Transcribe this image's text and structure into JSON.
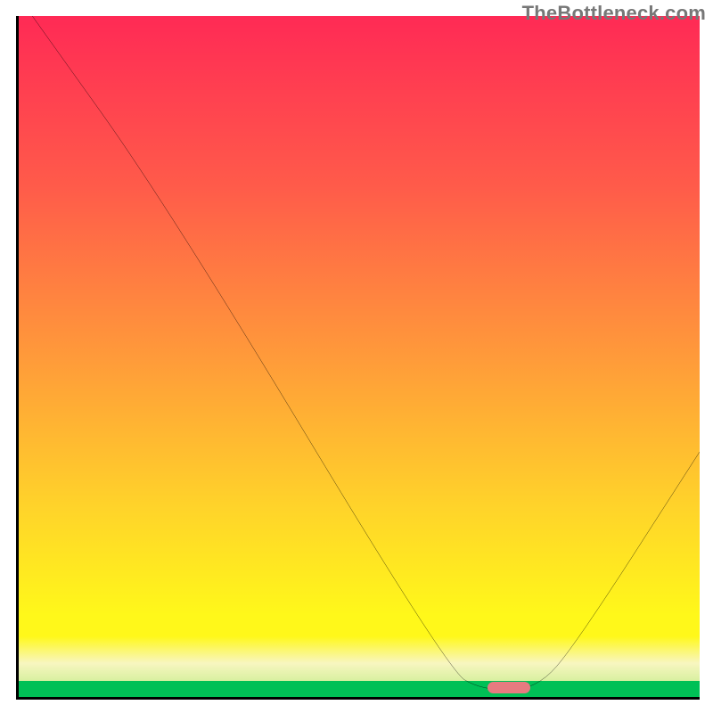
{
  "watermark": "TheBottleneck.com",
  "colors": {
    "gradient_stops": [
      {
        "offset": 0,
        "color": "#ff2a55"
      },
      {
        "offset": 25,
        "color": "#ff5b4a"
      },
      {
        "offset": 50,
        "color": "#ff9a3a"
      },
      {
        "offset": 72,
        "color": "#ffd32a"
      },
      {
        "offset": 88,
        "color": "#fff81a"
      },
      {
        "offset": 100,
        "color": "#fff81a"
      }
    ],
    "green_band": "#00c056",
    "marker": "#e77b80",
    "curve": "#000000"
  },
  "chart_data": {
    "type": "line",
    "title": "",
    "xlabel": "",
    "ylabel": "",
    "xlim": [
      0,
      100
    ],
    "ylim": [
      0,
      100
    ],
    "sweet_spot_x_range": [
      68,
      76
    ],
    "curve_points": [
      {
        "x": 2,
        "y": 100
      },
      {
        "x": 22,
        "y": 72
      },
      {
        "x": 63,
        "y": 4
      },
      {
        "x": 68,
        "y": 1
      },
      {
        "x": 76,
        "y": 1
      },
      {
        "x": 82,
        "y": 8
      },
      {
        "x": 100,
        "y": 36
      }
    ],
    "marker": {
      "x_center": 72,
      "y": 1.5
    }
  }
}
